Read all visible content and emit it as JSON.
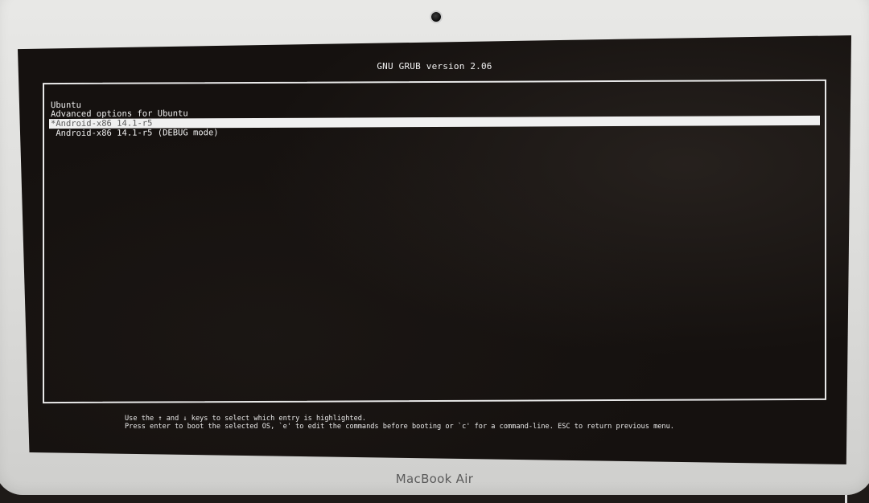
{
  "grub": {
    "title": "GNU GRUB  version 2.06",
    "menu": [
      {
        "label": "Ubuntu",
        "selected": false
      },
      {
        "label": "Advanced options for Ubuntu",
        "selected": false
      },
      {
        "label": "*Android-x86 14.1-r5",
        "selected": true
      },
      {
        "label": " Android-x86 14.1-r5 (DEBUG mode)",
        "selected": false
      }
    ],
    "help_line_1": "Use the ↑ and ↓ keys to select which entry is highlighted.",
    "help_line_2": "Press enter to boot the selected OS, `e' to edit the commands before booting or `c' for a command-line. ESC to return previous menu."
  },
  "device": {
    "brand_label": "MacBook Air"
  },
  "colors": {
    "screen_background": "#15110f",
    "text": "#efefef",
    "selection_background": "#f0f0f0",
    "selection_text": "#5a5a5a",
    "bezel": "#e3e3e1"
  }
}
